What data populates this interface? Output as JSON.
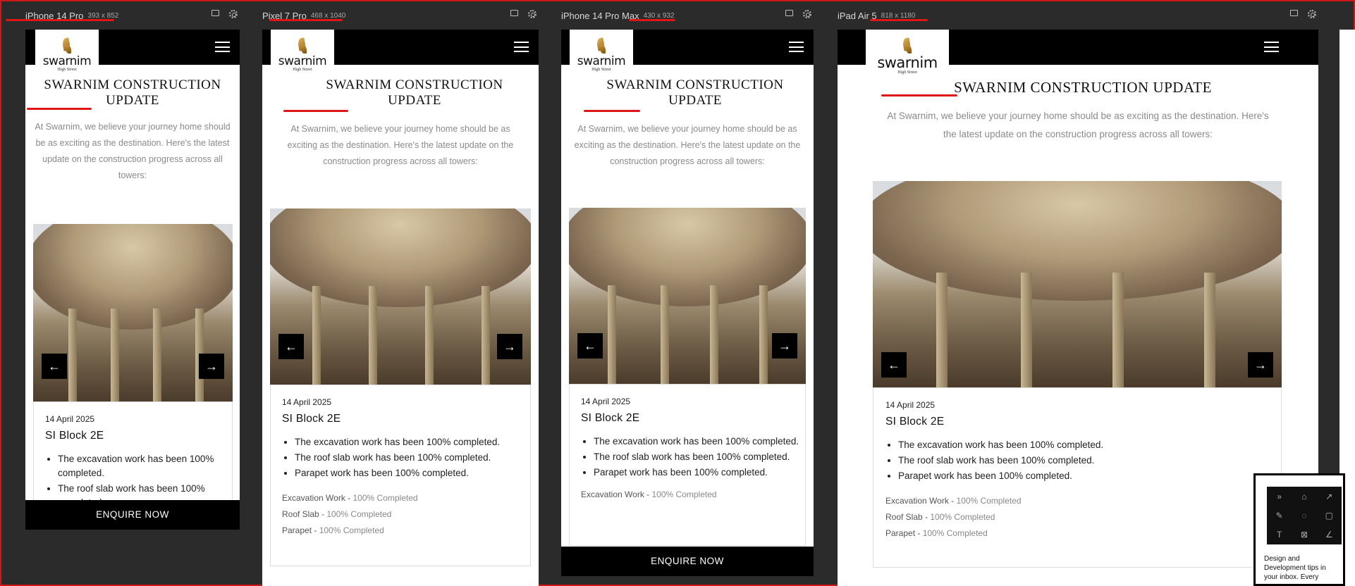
{
  "devices": [
    {
      "name": "iPhone 14 Pro",
      "dims": "393 x 852"
    },
    {
      "name": "Pixel 7 Pro",
      "dims": "468 x 1040"
    },
    {
      "name": "iPhone 14 Pro Max",
      "dims": "430 x 932"
    },
    {
      "name": "iPad Air 5",
      "dims": "818 x 1180"
    }
  ],
  "brand": {
    "name": "swarnim",
    "tagline": "High Street"
  },
  "page": {
    "headline_iphone14": "SWARNIM CONSTRUCTION UPDATE",
    "headline_pixel": "SWARNIM CONSTRUCTION UPDATE",
    "headline_max": "SWARNIM CONSTRUCTION UPDATE",
    "headline_ipad": "SWARNIM CONSTRUCTION UPDATE",
    "intro": "At Swarnim, we believe your journey home should be as exciting as the destination. Here's the latest update on the construction progress across all towers:",
    "date": "14 April 2025",
    "block": "SI Block 2E",
    "bullets": [
      "The excavation work has been 100% completed.",
      "The roof slab work has been 100% completed.",
      "Parapet work has been 100% completed."
    ],
    "status": [
      {
        "label": "Excavation Work -",
        "value": "100% Completed"
      },
      {
        "label": "Roof Slab -",
        "value": "100% Completed"
      },
      {
        "label": "Parapet -",
        "value": "100% Completed"
      }
    ],
    "enquire": "ENQUIRE NOW",
    "prev_arrow": "←",
    "next_arrow": "→"
  },
  "tips": {
    "text": "Design and Development tips in your inbox. Every"
  },
  "icons": [
    "menu-icon",
    "window-icon",
    "gear-icon",
    "arrow-left-icon",
    "arrow-right-icon"
  ]
}
